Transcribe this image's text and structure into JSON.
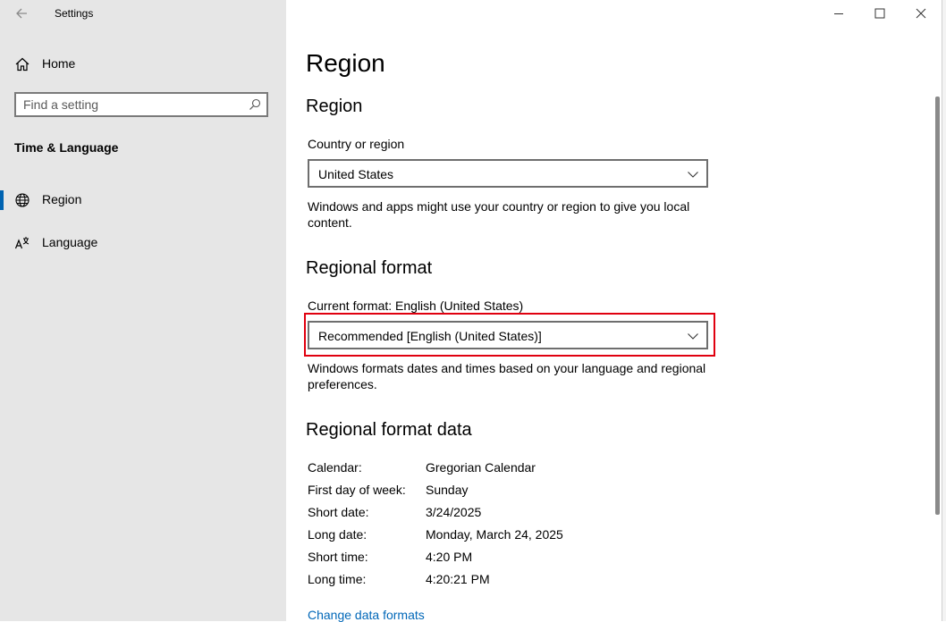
{
  "window": {
    "title": "Settings"
  },
  "sidebar": {
    "home_label": "Home",
    "search_placeholder": "Find a setting",
    "section_title": "Time & Language",
    "items": [
      {
        "label": "Region",
        "active": true
      },
      {
        "label": "Language",
        "active": false
      }
    ]
  },
  "main": {
    "page_title": "Region",
    "region_section": {
      "heading": "Region",
      "country_label": "Country or region",
      "country_value": "United States",
      "description": "Windows and apps might use your country or region to give you local content."
    },
    "format_section": {
      "heading": "Regional format",
      "current_format": "Current format: English (United States)",
      "format_value": "Recommended [English (United States)]",
      "description": "Windows formats dates and times based on your language and regional preferences."
    },
    "format_data_section": {
      "heading": "Regional format data",
      "rows": [
        {
          "key": "Calendar:",
          "value": "Gregorian Calendar"
        },
        {
          "key": "First day of week:",
          "value": "Sunday"
        },
        {
          "key": "Short date:",
          "value": "3/24/2025"
        },
        {
          "key": "Long date:",
          "value": "Monday, March 24, 2025"
        },
        {
          "key": "Short time:",
          "value": "4:20 PM"
        },
        {
          "key": "Long time:",
          "value": "4:20:21 PM"
        }
      ],
      "change_link": "Change data formats"
    }
  },
  "colors": {
    "sidebar_bg": "#e6e6e6",
    "accent": "#0063b1",
    "highlight": "#e0000f",
    "link": "#0067b8"
  }
}
